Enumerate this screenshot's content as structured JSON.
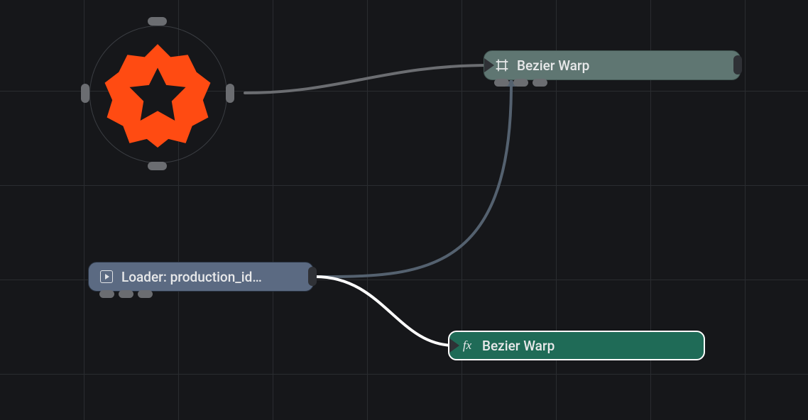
{
  "colors": {
    "accent_shape": "#ff4b12",
    "wire_default": "#6b6d71",
    "wire_muted": "#54616f",
    "wire_active": "#ffffff",
    "node_loader_bg": "#5b6a82",
    "node_bz1_bg": "#5f7672",
    "node_bz2_bg": "#1f6b57"
  },
  "shape_node": {
    "kind": "star-gear",
    "handles": [
      "top",
      "right",
      "bottom",
      "left"
    ]
  },
  "loader": {
    "label": "Loader: production_id…",
    "icon": "play-outline"
  },
  "bezier1": {
    "label": "Bezier Warp",
    "icon": "frame"
  },
  "bezier2": {
    "label": "Bezier Warp",
    "icon": "fx",
    "selected": true
  },
  "edges": [
    {
      "from": "shape_node.right",
      "to": "bezier1.in",
      "style": "default"
    },
    {
      "from": "loader.out",
      "to": "bezier1.bottom",
      "style": "muted"
    },
    {
      "from": "loader.out",
      "to": "bezier2.in",
      "style": "active"
    }
  ]
}
